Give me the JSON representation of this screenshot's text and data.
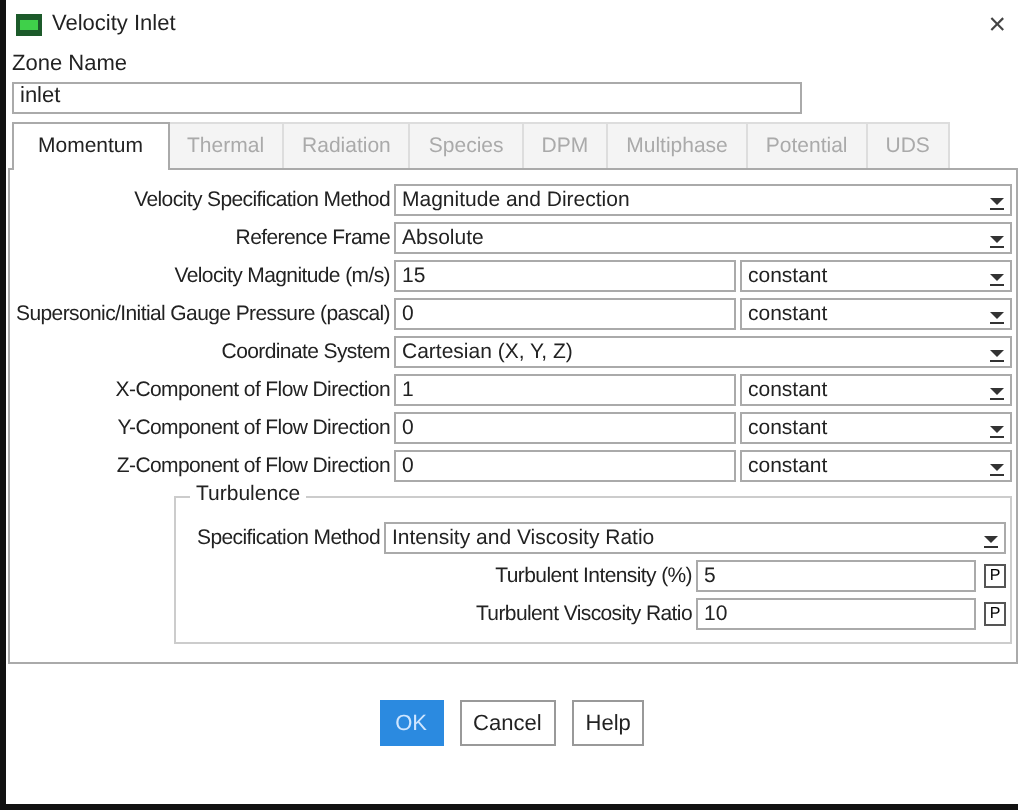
{
  "window": {
    "title": "Velocity Inlet",
    "close": "×"
  },
  "zone_name": {
    "label": "Zone Name",
    "value": "inlet"
  },
  "tabs": [
    {
      "label": "Momentum",
      "selected": true,
      "disabled": false
    },
    {
      "label": "Thermal",
      "selected": false,
      "disabled": true
    },
    {
      "label": "Radiation",
      "selected": false,
      "disabled": true
    },
    {
      "label": "Species",
      "selected": false,
      "disabled": true
    },
    {
      "label": "DPM",
      "selected": false,
      "disabled": true
    },
    {
      "label": "Multiphase",
      "selected": false,
      "disabled": true
    },
    {
      "label": "Potential",
      "selected": false,
      "disabled": true
    },
    {
      "label": "UDS",
      "selected": false,
      "disabled": true
    }
  ],
  "rows": [
    {
      "kind": "dropdown",
      "label": "Velocity Specification Method",
      "value": "Magnitude and Direction"
    },
    {
      "kind": "dropdown",
      "label": "Reference Frame",
      "value": "Absolute"
    },
    {
      "kind": "value",
      "label": "Velocity Magnitude (m/s)",
      "value": "15",
      "method": "constant"
    },
    {
      "kind": "value",
      "label": "Supersonic/Initial Gauge Pressure (pascal)",
      "value": "0",
      "method": "constant"
    },
    {
      "kind": "dropdown",
      "label": "Coordinate System",
      "value": "Cartesian (X, Y, Z)"
    },
    {
      "kind": "value",
      "label": "X-Component of Flow Direction",
      "value": "1",
      "method": "constant"
    },
    {
      "kind": "value",
      "label": "Y-Component of Flow Direction",
      "value": "0",
      "method": "constant"
    },
    {
      "kind": "value",
      "label": "Z-Component of Flow Direction",
      "value": "0",
      "method": "constant"
    }
  ],
  "turbulence": {
    "title": "Turbulence",
    "specification": {
      "label": "Specification Method",
      "value": "Intensity and Viscosity Ratio"
    },
    "params": [
      {
        "label": "Turbulent Intensity (%)",
        "value": "5",
        "button": "P"
      },
      {
        "label": "Turbulent Viscosity Ratio",
        "value": "10",
        "button": "P"
      }
    ]
  },
  "buttons": [
    {
      "label": "OK",
      "kind": "primary"
    },
    {
      "label": "Cancel",
      "kind": "normal"
    },
    {
      "label": "Help",
      "kind": "normal"
    }
  ]
}
